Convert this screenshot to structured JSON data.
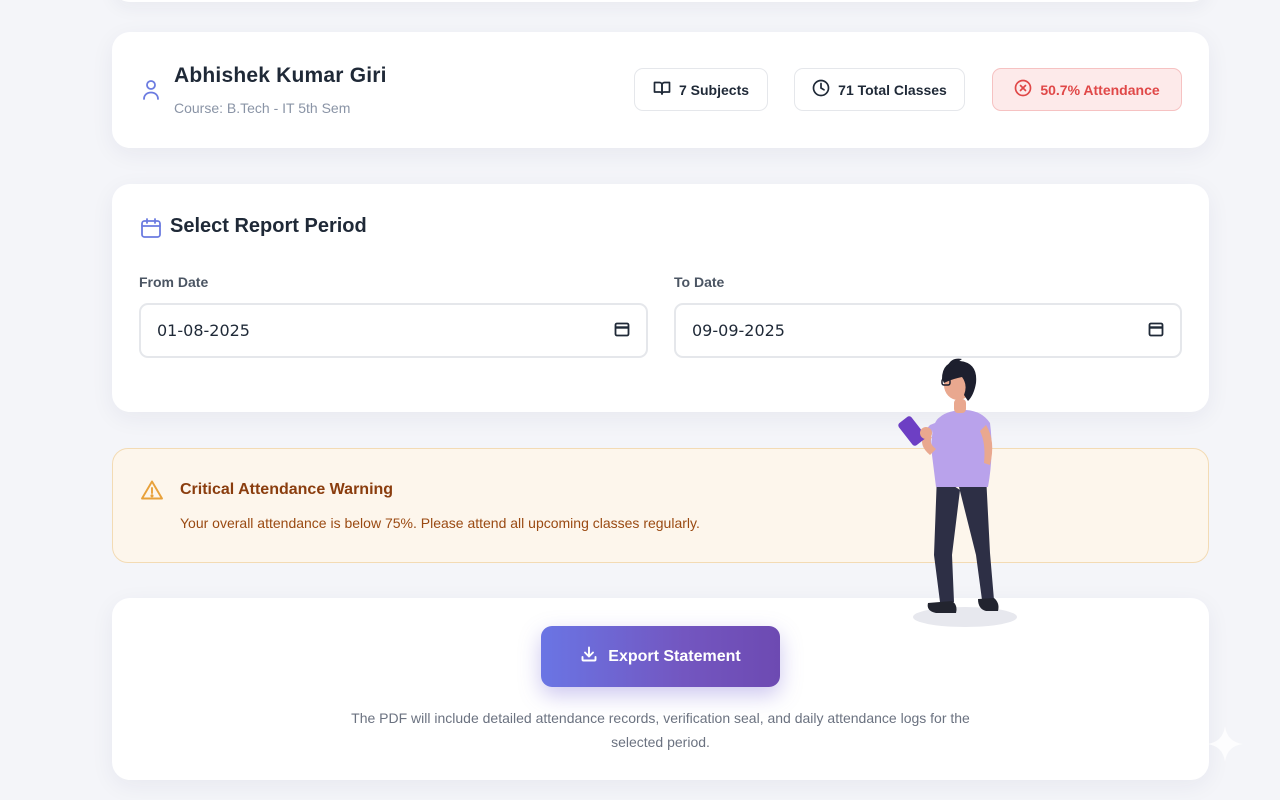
{
  "profile": {
    "name": "Abhishek Kumar Giri",
    "course": "Course: B.Tech - IT 5th Sem",
    "stats": {
      "subjects": "7 Subjects",
      "classes": "71 Total Classes",
      "attendance": "50.7% Attendance"
    }
  },
  "report_period": {
    "title": "Select Report Period",
    "from_label": "From Date",
    "from_value": "01-08-2025",
    "to_label": "To Date",
    "to_value": "09-09-2025"
  },
  "warning": {
    "title": "Critical Attendance Warning",
    "message": "Your overall attendance is below 75%. Please attend all upcoming classes regularly."
  },
  "export": {
    "button_label": "Export Statement",
    "note": "The PDF will include detailed attendance records, verification seal, and daily attendance logs for the selected period."
  },
  "colors": {
    "accent": "#6a75e4",
    "danger": "#e04848",
    "warning": "#e8a13a"
  }
}
